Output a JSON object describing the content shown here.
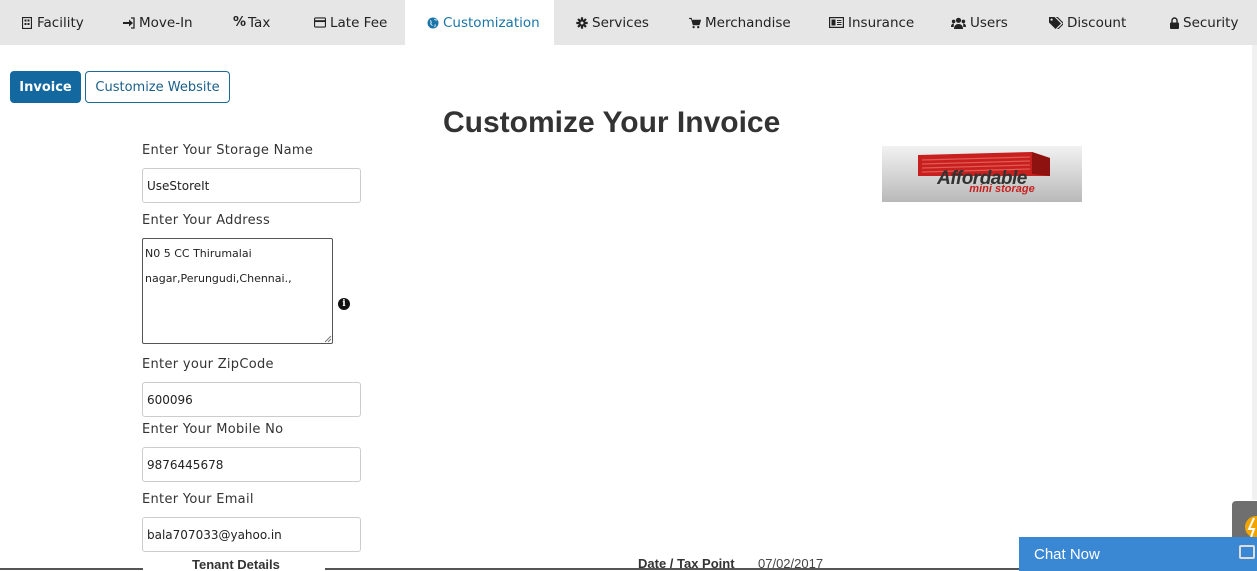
{
  "nav": {
    "tabs": [
      {
        "label": "Facility",
        "icon": "building-icon"
      },
      {
        "label": "Move-In",
        "icon": "sign-in-icon"
      },
      {
        "label": "Tax",
        "icon": "percent-icon"
      },
      {
        "label": "Late Fee",
        "icon": "credit-card-icon"
      },
      {
        "label": "Customization",
        "icon": "globe-icon"
      },
      {
        "label": "Services",
        "icon": "gear-icon"
      },
      {
        "label": "Merchandise",
        "icon": "cart-icon"
      },
      {
        "label": "Insurance",
        "icon": "id-card-icon"
      },
      {
        "label": "Users",
        "icon": "users-icon"
      },
      {
        "label": "Discount",
        "icon": "tags-icon"
      },
      {
        "label": "Security",
        "icon": "lock-icon"
      }
    ],
    "active": "Customization"
  },
  "subnav": {
    "invoice_label": "Invoice",
    "website_label": "Customize Website"
  },
  "page": {
    "title": "Customize Your Invoice"
  },
  "form": {
    "storage_name_label": "Enter Your Storage Name",
    "storage_name_value": "UseStoreIt",
    "address_label": "Enter Your Address",
    "address_value": "N0 5 CC Thirumalai nagar,Perungudi,Chennai.,",
    "zip_label": "Enter your ZipCode",
    "zip_value": "600096",
    "mobile_label": "Enter Your Mobile No",
    "mobile_value": "9876445678",
    "email_label": "Enter Your Email",
    "email_value": "bala707033@yahoo.in"
  },
  "logo": {
    "main": "Affordable",
    "sub": "mini storage"
  },
  "invoice": {
    "tenant_details_label": "Tenant Details",
    "date_label": "Date / Tax Point",
    "date_value": "07/02/2017"
  },
  "chat": {
    "label": "Chat Now"
  },
  "colors": {
    "accent": "#1468a0",
    "nav_bg": "#e6e6e6",
    "chat_bg": "#3a87d4",
    "logo_red": "#c8201e"
  }
}
